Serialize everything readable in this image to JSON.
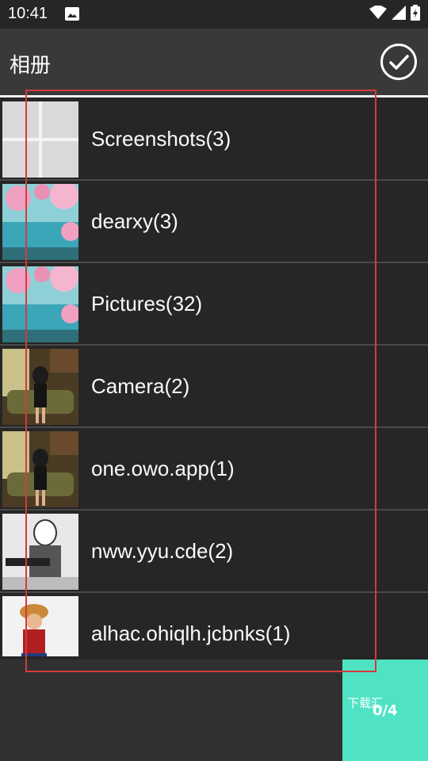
{
  "status_bar": {
    "time": "10:41",
    "icons": [
      "image-icon",
      "wifi-icon",
      "signal-icon",
      "battery-icon"
    ]
  },
  "app_bar": {
    "title": "相册",
    "confirm_icon": "check-circle-icon"
  },
  "albums": [
    {
      "label": "Screenshots(3)",
      "thumb": "screenshot-grid"
    },
    {
      "label": "dearxy(3)",
      "thumb": "cherry-blossom-lake"
    },
    {
      "label": "Pictures(32)",
      "thumb": "cherry-blossom-lake"
    },
    {
      "label": "Camera(2)",
      "thumb": "woman-on-sofa"
    },
    {
      "label": "one.owo.app(1)",
      "thumb": "woman-on-sofa"
    },
    {
      "label": "nww.yyu.cde(2)",
      "thumb": "manga-character"
    },
    {
      "label": "alhac.ohiqlh.jcbnks(1)",
      "thumb": "anime-character"
    }
  ],
  "bottom_bar": {
    "action_label": "下载汇",
    "counter": "0/4",
    "accent_color": "#4fe3c4"
  },
  "annotation": {
    "color": "#d53a3a"
  }
}
